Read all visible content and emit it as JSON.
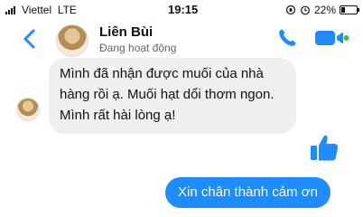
{
  "status_bar": {
    "carrier": "Viettel",
    "network": "LTE",
    "time": "19:15",
    "battery": "22%",
    "battery_level": 0.22
  },
  "header": {
    "contact_name": "Liên Bùi",
    "status": "Đang hoạt động",
    "back_icon": "chevron-left-icon",
    "call_icon": "phone-icon",
    "video_icon": "video-camera-icon",
    "accent": "#1e8bff"
  },
  "messages": [
    {
      "direction": "incoming",
      "text": "Mình đã nhận được muối của nhà hàng rồi ạ. Muối hạt dổi thơm ngon. Mình rất hài lòng  ạ!"
    },
    {
      "direction": "outgoing",
      "text": "Xin chân thành cảm ơn"
    }
  ],
  "reaction_icon": "thumbs-up-icon"
}
